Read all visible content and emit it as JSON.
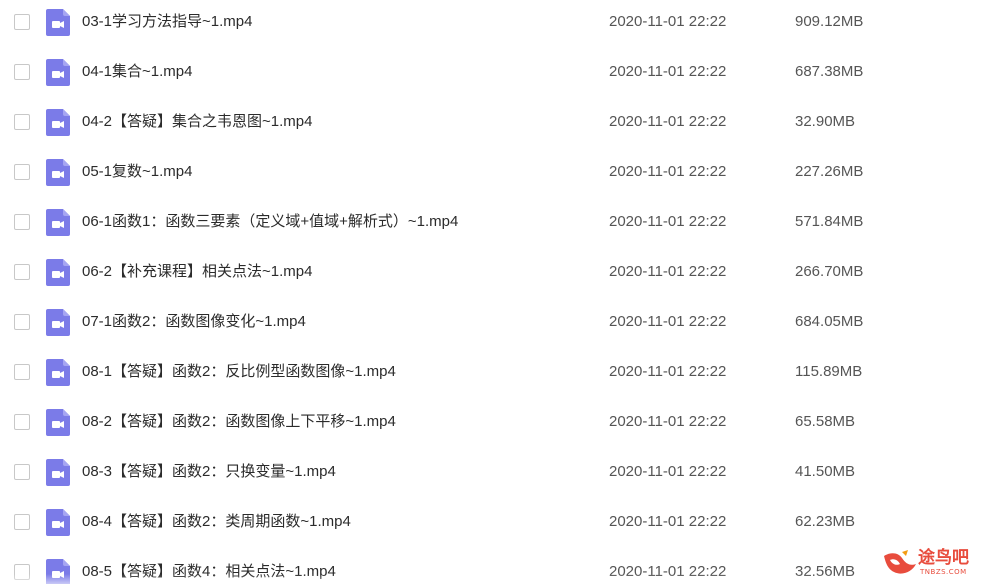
{
  "colors": {
    "file_icon": "#7b7be8",
    "text": "#2b2b2b",
    "meta_text": "#555555",
    "checkbox_border": "#c8c8c8",
    "watermark": "#e84c3d"
  },
  "file_icon_name": "video-file-icon",
  "files": [
    {
      "name": "03-1学习方法指导~1.mp4",
      "date": "2020-11-01 22:22",
      "size": "909.12MB",
      "checked": false
    },
    {
      "name": "04-1集合~1.mp4",
      "date": "2020-11-01 22:22",
      "size": "687.38MB",
      "checked": false
    },
    {
      "name": "04-2【答疑】集合之韦恩图~1.mp4",
      "date": "2020-11-01 22:22",
      "size": "32.90MB",
      "checked": false
    },
    {
      "name": "05-1复数~1.mp4",
      "date": "2020-11-01 22:22",
      "size": "227.26MB",
      "checked": false
    },
    {
      "name": "06-1函数1：函数三要素（定义域+值域+解析式）~1.mp4",
      "date": "2020-11-01 22:22",
      "size": "571.84MB",
      "checked": false
    },
    {
      "name": "06-2【补充课程】相关点法~1.mp4",
      "date": "2020-11-01 22:22",
      "size": "266.70MB",
      "checked": false
    },
    {
      "name": "07-1函数2：函数图像变化~1.mp4",
      "date": "2020-11-01 22:22",
      "size": "684.05MB",
      "checked": false
    },
    {
      "name": "08-1【答疑】函数2：反比例型函数图像~1.mp4",
      "date": "2020-11-01 22:22",
      "size": "115.89MB",
      "checked": false
    },
    {
      "name": "08-2【答疑】函数2：函数图像上下平移~1.mp4",
      "date": "2020-11-01 22:22",
      "size": "65.58MB",
      "checked": false
    },
    {
      "name": "08-3【答疑】函数2：只换变量~1.mp4",
      "date": "2020-11-01 22:22",
      "size": "41.50MB",
      "checked": false
    },
    {
      "name": "08-4【答疑】函数2：类周期函数~1.mp4",
      "date": "2020-11-01 22:22",
      "size": "62.23MB",
      "checked": false
    },
    {
      "name": "08-5【答疑】函数4：相关点法~1.mp4",
      "date": "2020-11-01 22:22",
      "size": "32.56MB",
      "checked": false
    }
  ],
  "watermark": {
    "title": "途鸟吧",
    "subtitle": "TNBZS.COM"
  }
}
